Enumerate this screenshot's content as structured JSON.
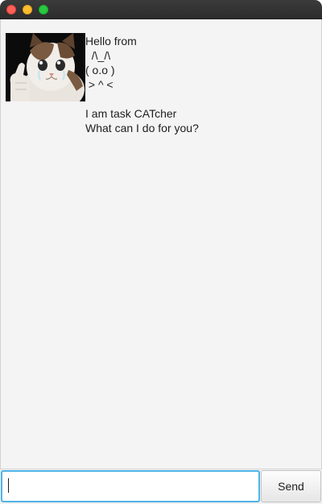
{
  "window": {
    "controls": [
      "close",
      "minimize",
      "zoom"
    ]
  },
  "dialog": {
    "speaker_avatar": "cat-thumbs-up-avatar",
    "message": "Hello from\n  /\\_/\\\n( o.o )\n > ^ <\n\nI am task CATcher\nWhat can I do for you?"
  },
  "input": {
    "value": "",
    "placeholder": ""
  },
  "send_button": {
    "label": "Send"
  },
  "colors": {
    "close": "#fe5f57",
    "minimize": "#febc2e",
    "zoom": "#28c840",
    "input_focus_border": "#4fb3e8",
    "background": "#f4f4f4"
  }
}
